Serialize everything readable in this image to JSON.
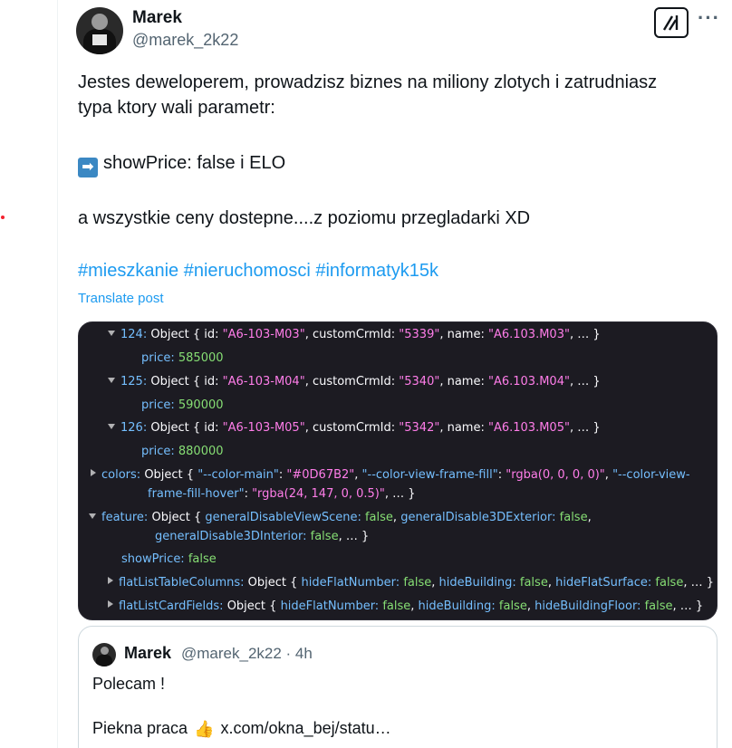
{
  "author": {
    "name": "Marek",
    "handle": "@marek_2k22"
  },
  "icons": {
    "grok": "grok-icon",
    "more": "more-icon",
    "arrow": "right-arrow-emoji",
    "thumbs_up": "thumbs-up-emoji"
  },
  "tweet": {
    "line1": "Jestes deweloperem, prowadzisz biznes na miliony zlotych i zatrudniasz",
    "line2": "typa ktory wali parametr:",
    "line3": "showPrice: false i ELO",
    "line4": "a wszystkie ceny dostepne....z poziomu przegladarki XD",
    "hashtags": "#mieszkanie #nieruchomosci #informatyk15k",
    "translate": "Translate post"
  },
  "code": {
    "items": [
      {
        "idx": "124:",
        "obj": "Object { id: ",
        "id": "\"A6-103-M03\"",
        "crm_key": ", customCrmId: ",
        "crm": "\"5339\"",
        "name_key": ", name: ",
        "name": "\"A6.103.M03\"",
        "tail": ", … }",
        "price_key": "price:",
        "price": "585000"
      },
      {
        "idx": "125:",
        "obj": "Object { id: ",
        "id": "\"A6-103-M04\"",
        "crm_key": ", customCrmId: ",
        "crm": "\"5340\"",
        "name_key": ", name: ",
        "name": "\"A6.103.M04\"",
        "tail": ", … }",
        "price_key": "price:",
        "price": "590000"
      },
      {
        "idx": "126:",
        "obj": "Object { id: ",
        "id": "\"A6-103-M05\"",
        "crm_key": ", customCrmId: ",
        "crm": "\"5342\"",
        "name_key": ", name: ",
        "name": "\"A6.103.M05\"",
        "tail": ", … }",
        "price_key": "price:",
        "price": "880000"
      }
    ],
    "colors_key": "colors:",
    "colors_obj": "Object { ",
    "colors_k1": "\"--color-main\"",
    "colors_v1": "\"#0D67B2\"",
    "colors_k2": "\"--color-view-frame-fill\"",
    "colors_v2": "\"rgba(0, 0, 0, 0)\"",
    "colors_k3a": "\"--color-view-",
    "colors_k3b": "frame-fill-hover\"",
    "colors_v3": "\"rgba(24, 147, 0, 0.5)\"",
    "colors_tail": ", … }",
    "feature_key": "feature:",
    "feature_obj": "Object { ",
    "f_k1": "generalDisableViewScene:",
    "f_v1": "false",
    "f_k2": "generalDisable3DExterior:",
    "f_v2": "false",
    "f_k3": "generalDisable3DInterior:",
    "f_v3": "false",
    "f_tail": ", … }",
    "show_key": "showPrice:",
    "show_val": "false",
    "flt_key": "flatListTableColumns:",
    "flt_obj": "Object { ",
    "flt_k1": "hideFlatNumber:",
    "flt_v1": "false",
    "flt_k2": "hideBuilding:",
    "flt_v2": "false",
    "flt_k3": "hideFlatSurface:",
    "flt_v3": "false",
    "flt_tail": ", … }",
    "flc_key": "flatListCardFields:",
    "flc_obj": "Object { ",
    "flc_k1": "hideFlatNumber:",
    "flc_v1": "false",
    "flc_k2": "hideBuilding:",
    "flc_v2": "false",
    "flc_k3": "hideBuildingFloor:",
    "flc_v3": "false",
    "flc_tail": ", … }"
  },
  "quote": {
    "name": "Marek",
    "handle_time": "@marek_2k22 · 4h",
    "text1": "Polecam !",
    "text2_a": "Piekna praca",
    "text2_b": "x.com/okna_bej/statu…"
  },
  "colors": {
    "link": "#1d9bf0",
    "muted": "#536471",
    "code_bg": "#1c1b22",
    "code_key": "#75bfff",
    "code_string": "#ff7de9",
    "code_number": "#86de74"
  }
}
